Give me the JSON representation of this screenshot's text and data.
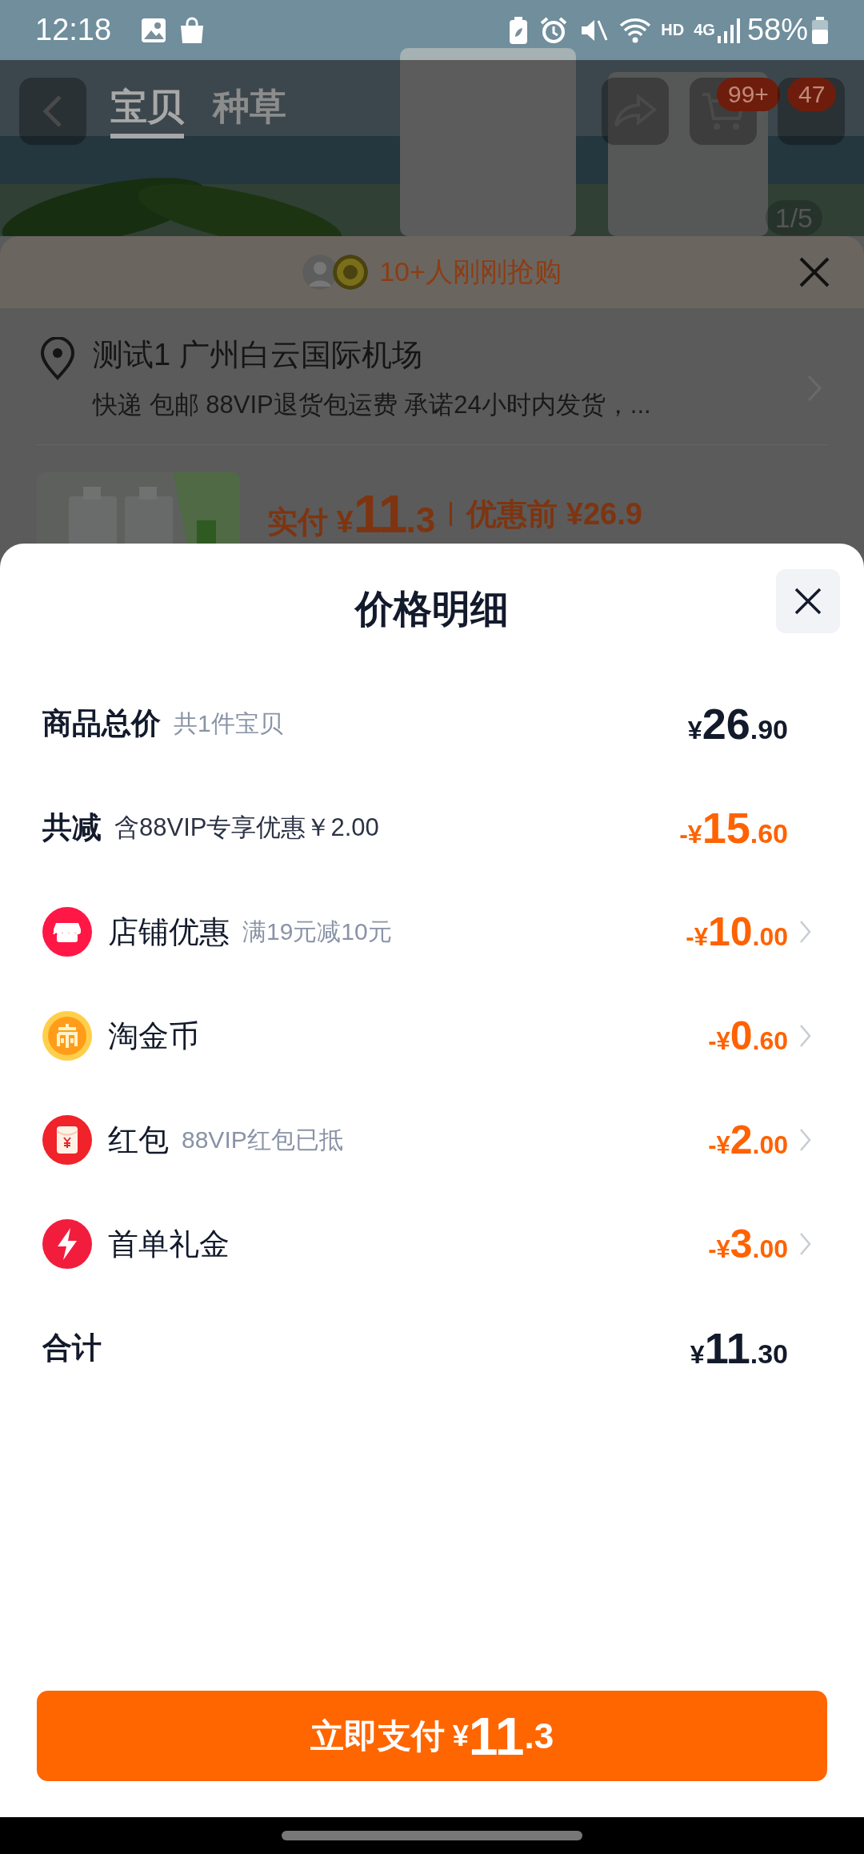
{
  "status_bar": {
    "time": "12:18",
    "hd": "HD",
    "network": "4G",
    "battery": "58%"
  },
  "product_page": {
    "tabs": [
      {
        "label": "宝贝",
        "selected": true
      },
      {
        "label": "种草",
        "selected": false
      }
    ],
    "cart_badge": "99+",
    "message_badge": "47",
    "image_counter": "1/5"
  },
  "order_sheet": {
    "buyers_banner": "10+人刚刚抢购",
    "address": "测试1 广州白云国际机场",
    "delivery": "快递 包邮 88VIP退货包运费 承诺24小时内发货，...",
    "paid": "实付 ¥11.3",
    "original_price": "优惠前 ¥26.9"
  },
  "price_details": {
    "title": "价格明细",
    "rows": [
      {
        "kind": "subtotal",
        "label": "商品总价",
        "note": "共1件宝贝",
        "amount": "¥26.90"
      },
      {
        "kind": "reduction",
        "label": "共减",
        "note": "含88VIP专享优惠￥2.00",
        "amount": "-¥15.60"
      },
      {
        "kind": "store",
        "label": "店铺优惠",
        "note": "满19元减10元",
        "amount": "-¥10.00"
      },
      {
        "kind": "coin",
        "label": "淘金币",
        "amount": "-¥0.60"
      },
      {
        "kind": "envelope",
        "label": "红包",
        "note": "88VIP红包已抵",
        "amount": "-¥2.00"
      },
      {
        "kind": "flash",
        "label": "首单礼金",
        "amount": "-¥3.00"
      },
      {
        "kind": "total",
        "label": "合计",
        "amount": "¥11.30"
      }
    ],
    "pay_button": {
      "label": "立即支付",
      "amount": "¥11.3"
    }
  }
}
